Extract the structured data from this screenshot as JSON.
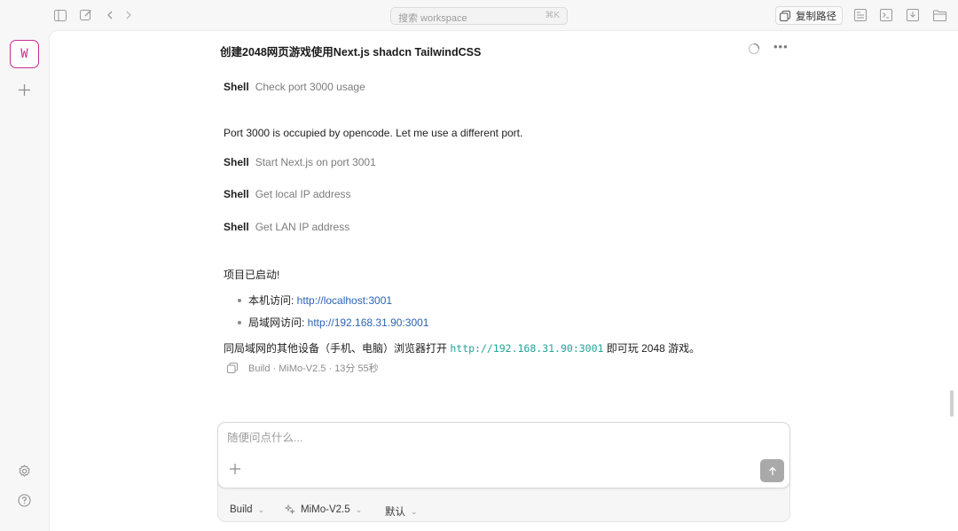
{
  "topbar": {
    "search_placeholder": "搜索 workspace",
    "search_shortcut": "⌘K",
    "copy_path_label": "复制路径"
  },
  "rail": {
    "workspace_initial": "W"
  },
  "session": {
    "title": "创建2048网页游戏使用Next.js shadcn TailwindCSS"
  },
  "messages": {
    "shell_tag": "Shell",
    "shell_1": "Check port 3000 usage",
    "para_1": "Port 3000 is occupied by opencode. Let me use a different port.",
    "shell_2": "Start Next.js on port 3001",
    "shell_3": "Get local IP address",
    "shell_4": "Get LAN IP address",
    "status": "项目已启动!",
    "bullets": [
      {
        "label": "本机访问: ",
        "url": "http://localhost:3001"
      },
      {
        "label": "局域网访问: ",
        "url": "http://192.168.31.90:3001"
      }
    ],
    "final_prefix": "同局域网的其他设备（手机、电脑）浏览器打开 ",
    "final_code": "http://192.168.31.90:3001",
    "final_suffix": " 即可玩 2048 游戏。",
    "meta": "Build · MiMo-V2.5 · 13分 55秒"
  },
  "composer": {
    "placeholder": "随便问点什么...",
    "agent": "Build",
    "model": "MiMo-V2.5",
    "variant": "默认"
  },
  "colors": {
    "accent": "#c72d8f",
    "link": "#2a63b6",
    "code": "#22a39a"
  }
}
